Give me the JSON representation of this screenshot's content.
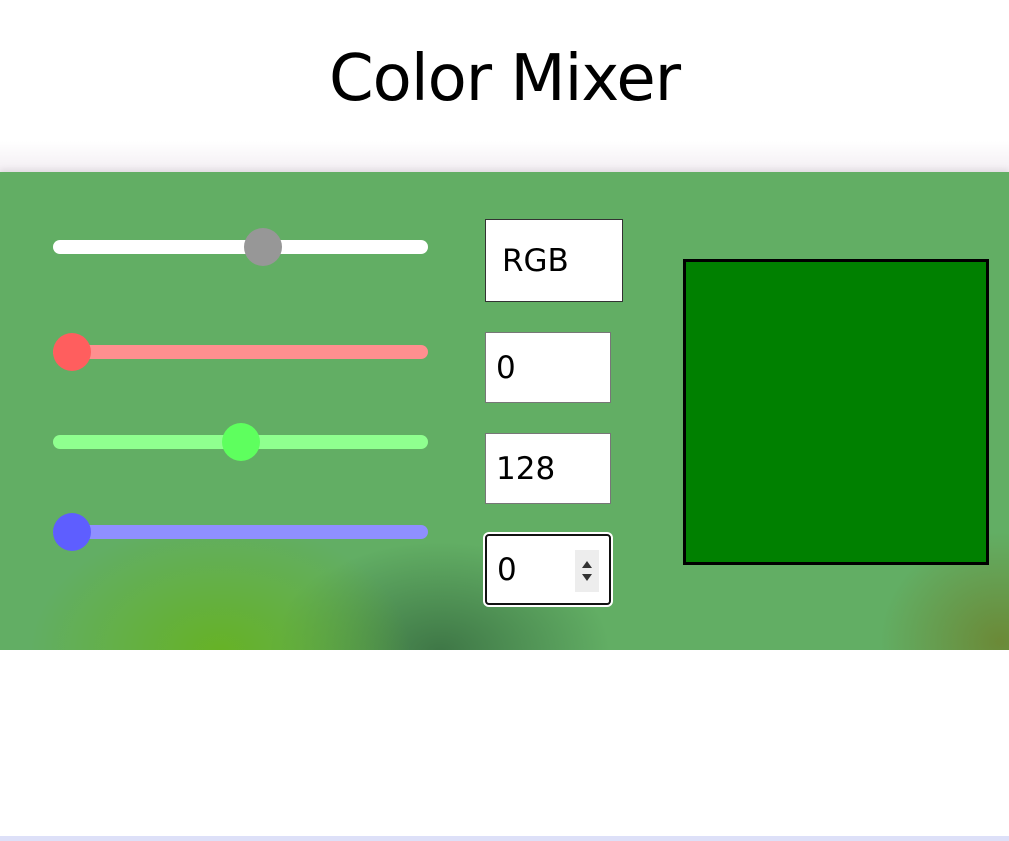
{
  "title": "Color Mixer",
  "mode": {
    "label": "RGB",
    "slider_fraction": 0.56
  },
  "channels": {
    "r": {
      "value": "0",
      "slider_fraction": 0.05,
      "color": "#ff5e5e"
    },
    "g": {
      "value": "128",
      "slider_fraction": 0.5,
      "color": "#5eff5e"
    },
    "b": {
      "value": "0",
      "slider_fraction": 0.05,
      "color": "#5e5eff"
    }
  },
  "preview": {
    "color": "#008000"
  },
  "icons": {
    "spinner_up": "triangle-up-icon",
    "spinner_down": "triangle-down-icon"
  }
}
